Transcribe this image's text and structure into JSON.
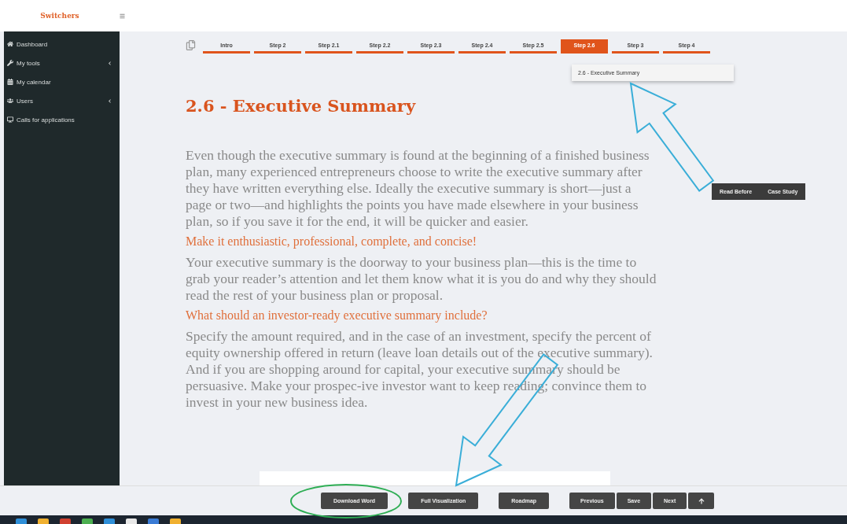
{
  "header": {
    "logo": "Switchers"
  },
  "sidebar": {
    "items": [
      {
        "label": "Dashboard",
        "has_submenu": false
      },
      {
        "label": "My tools",
        "has_submenu": true
      },
      {
        "label": "My calendar",
        "has_submenu": false
      },
      {
        "label": "Users",
        "has_submenu": true
      },
      {
        "label": "Calls for applications",
        "has_submenu": false
      }
    ]
  },
  "steps": [
    {
      "label": "Intro",
      "selected": false
    },
    {
      "label": "Step 2",
      "selected": false
    },
    {
      "label": "Step 2.1",
      "selected": false
    },
    {
      "label": "Step 2.2",
      "selected": false
    },
    {
      "label": "Step 2.3",
      "selected": false
    },
    {
      "label": "Step 2.4",
      "selected": false
    },
    {
      "label": "Step 2.5",
      "selected": false
    },
    {
      "label": "Step 2.6",
      "selected": true
    },
    {
      "label": "Step 3",
      "selected": false
    },
    {
      "label": "Step 4",
      "selected": false
    }
  ],
  "step_menu": {
    "items": [
      "2.6 - Executive Summary"
    ]
  },
  "side_buttons": [
    "Read Before",
    "Case Study"
  ],
  "article": {
    "title": "2.6 - Executive Summary",
    "blocks": [
      {
        "kind": "paragraph",
        "text": "Even though the executive summary is found at the beginning of a finished business plan, many experienced entrepreneurs choose to write the executive summary after they have written everything else. Ideally the executive summary is short—just a page or two—and highlights the points you have made elsewhere in your business plan, so if you save it for the end, it will be quicker and easier."
      },
      {
        "kind": "subheading",
        "text": "Make it enthusiastic, professional, complete, and concise!"
      },
      {
        "kind": "paragraph",
        "text": "Your executive summary is the doorway to your business plan—this is the time to grab your reader’s attention and let them know what it is you do and why they should read the rest of your business plan or proposal."
      },
      {
        "kind": "subheading",
        "text": "What should an investor-ready executive summary include?"
      },
      {
        "kind": "paragraph",
        "text": "Specify the amount required, and in the case of an investment, specify the percent of equity ownership offered in return (leave loan details out of the executive summary). And if you are shopping around for capital, your executive summary should be persuasive. Make your prospec-ive investor want to keep reading; convince them to invest in your new business idea."
      }
    ]
  },
  "footer_buttons": [
    {
      "label": "Download Word",
      "kind": "single"
    },
    {
      "label": "Full Visualization",
      "kind": "single"
    },
    {
      "label": "Roadmap",
      "kind": "single"
    },
    {
      "label": "Previous",
      "kind": "nav"
    },
    {
      "label": "Save",
      "kind": "nav"
    },
    {
      "label": "Next",
      "kind": "nav"
    }
  ]
}
